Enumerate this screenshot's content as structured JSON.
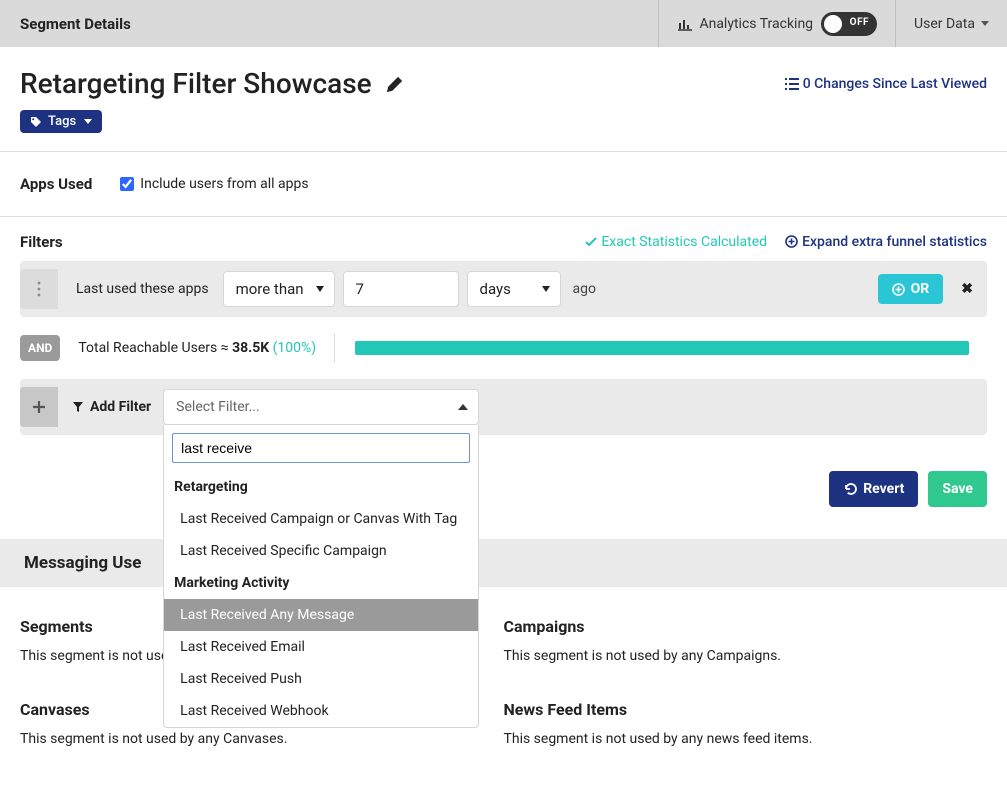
{
  "topbar": {
    "title": "Segment Details",
    "analytics_label": "Analytics Tracking",
    "analytics_state": "OFF",
    "userdata_label": "User Data"
  },
  "header": {
    "title": "Retargeting Filter Showcase",
    "changes": "0 Changes Since Last Viewed",
    "tags_label": "Tags"
  },
  "apps": {
    "label": "Apps Used",
    "include_label": "Include users from all apps",
    "include_checked": true
  },
  "filters": {
    "label": "Filters",
    "exact_label": "Exact Statistics Calculated",
    "expand_label": "Expand extra funnel statistics",
    "rule": {
      "label": "Last used these apps",
      "op": "more than",
      "value": "7",
      "unit": "days",
      "suffix": "ago"
    },
    "or_label": "OR",
    "and_label": "AND",
    "reach_prefix": "Total Reachable Users ≈ ",
    "reach_num": "38.5K",
    "reach_pct": "(100%)",
    "add_label": "Add Filter",
    "select_placeholder": "Select Filter...",
    "search_value": "last receive",
    "groups": [
      {
        "label": "Retargeting",
        "options": [
          "Last Received Campaign or Canvas With Tag",
          "Last Received Specific Campaign"
        ]
      },
      {
        "label": "Marketing Activity",
        "options": [
          "Last Received Any Message",
          "Last Received Email",
          "Last Received Push",
          "Last Received Webhook"
        ]
      }
    ],
    "highlight": "Last Received Any Message"
  },
  "actions": {
    "revert": "Revert",
    "save": "Save"
  },
  "messaging": {
    "title": "Messaging Use",
    "cells": [
      {
        "h": "Segments",
        "p": "This segment is not used by any other segments."
      },
      {
        "h": "Campaigns",
        "p": "This segment is not used by any Campaigns."
      },
      {
        "h": "Canvases",
        "p": "This segment is not used by any Canvases."
      },
      {
        "h": "News Feed Items",
        "p": "This segment is not used by any news feed items."
      }
    ]
  }
}
